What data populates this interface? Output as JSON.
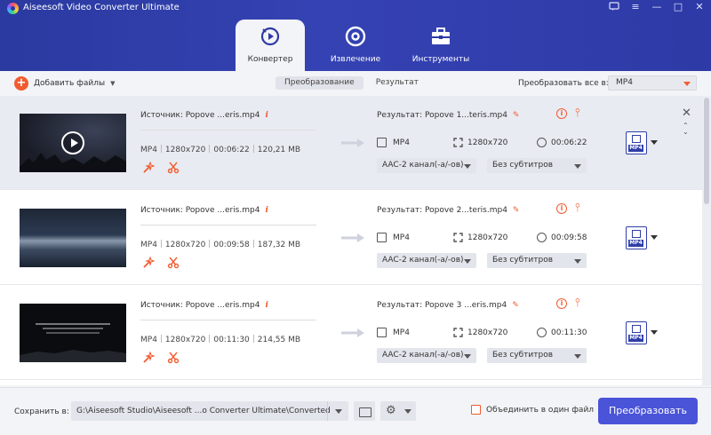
{
  "app": {
    "title": "Aiseesoft Video Converter Ultimate"
  },
  "window_controls": [
    "feedback-icon",
    "menu-icon",
    "minimize-icon",
    "maximize-icon",
    "close-icon"
  ],
  "tabs": [
    {
      "label": "Конвертер",
      "icon": "converter-icon",
      "active": true
    },
    {
      "label": "Извлечение",
      "icon": "ripper-icon",
      "active": false
    },
    {
      "label": "Инструменты",
      "icon": "toolbox-icon",
      "active": false
    }
  ],
  "toolbar": {
    "add_files_label": "Добавить файлы",
    "segments": [
      "Преобразование",
      "Результат"
    ],
    "convert_all_label": "Преобразовать все в:",
    "convert_all_value": "MP4"
  },
  "files": [
    {
      "source": "Источник: Popove ...eris.mp4",
      "format": "MP4",
      "resolution": "1280x720",
      "duration": "00:06:22",
      "size": "120,21 MB",
      "result": "Результат: Popove 1...teris.mp4",
      "out_format": "MP4",
      "out_resolution": "1280x720",
      "out_duration": "00:06:22",
      "audio": "AAC-2 канал(-а/-ов)",
      "subtitle": "Без субтитров",
      "badge": "MP4"
    },
    {
      "source": "Источник: Popove ...eris.mp4",
      "format": "MP4",
      "resolution": "1280x720",
      "duration": "00:09:58",
      "size": "187,32 MB",
      "result": "Результат: Popove 2...teris.mp4",
      "out_format": "MP4",
      "out_resolution": "1280x720",
      "out_duration": "00:09:58",
      "audio": "AAC-2 канал(-а/-ов)",
      "subtitle": "Без субтитров",
      "badge": "MP4"
    },
    {
      "source": "Источник: Popove ...eris.mp4",
      "format": "MP4",
      "resolution": "1280x720",
      "duration": "00:11:30",
      "size": "214,55 MB",
      "result": "Результат: Popove 3 ...eris.mp4",
      "out_format": "MP4",
      "out_resolution": "1280x720",
      "out_duration": "00:11:30",
      "audio": "AAC-2 канал(-а/-ов)",
      "subtitle": "Без субтитров",
      "badge": "MP4"
    }
  ],
  "bottom": {
    "save_label": "Сохранить в:",
    "save_path": "G:\\Aiseesoft Studio\\Aiseesoft ...o Converter Ultimate\\Converted",
    "merge_label": "Объединить в один файл",
    "convert_button": "Преобразовать"
  },
  "colors": {
    "accent": "#f25b2f",
    "header": "#2e3aa6",
    "primary_button": "#4a54d8"
  }
}
